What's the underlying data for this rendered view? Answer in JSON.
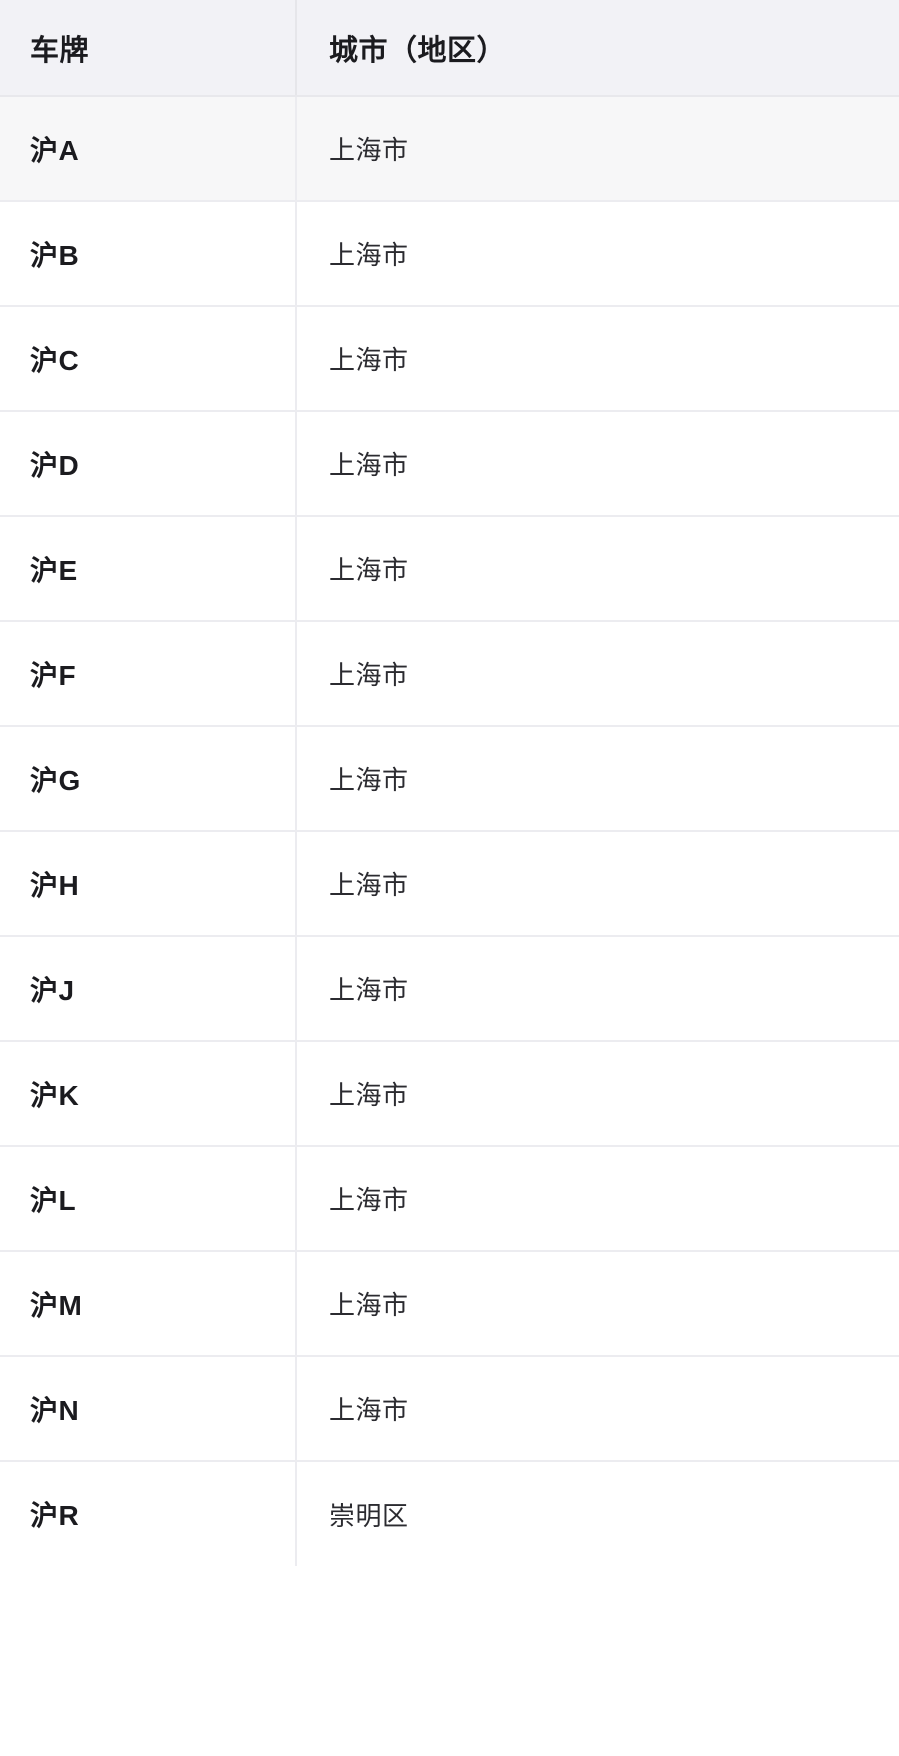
{
  "table": {
    "columns": [
      {
        "key": "plate",
        "label": "车牌"
      },
      {
        "key": "city",
        "label": "城市（地区）"
      }
    ],
    "rows": [
      {
        "plate": "沪A",
        "city": "上海市"
      },
      {
        "plate": "沪B",
        "city": "上海市"
      },
      {
        "plate": "沪C",
        "city": "上海市"
      },
      {
        "plate": "沪D",
        "city": "上海市"
      },
      {
        "plate": "沪E",
        "city": "上海市"
      },
      {
        "plate": "沪F",
        "city": "上海市"
      },
      {
        "plate": "沪G",
        "city": "上海市"
      },
      {
        "plate": "沪H",
        "city": "上海市"
      },
      {
        "plate": "沪J",
        "city": "上海市"
      },
      {
        "plate": "沪K",
        "city": "上海市"
      },
      {
        "plate": "沪L",
        "city": "上海市"
      },
      {
        "plate": "沪M",
        "city": "上海市"
      },
      {
        "plate": "沪N",
        "city": "上海市"
      },
      {
        "plate": "沪R",
        "city": "崇明区"
      }
    ]
  },
  "colors": {
    "header_background": "#f2f2f6",
    "row_alt_background": "#f7f7f8",
    "row_background": "#ffffff",
    "border": "#ececf0",
    "header_text": "#1b1b1f",
    "body_text": "#2b2b30"
  }
}
